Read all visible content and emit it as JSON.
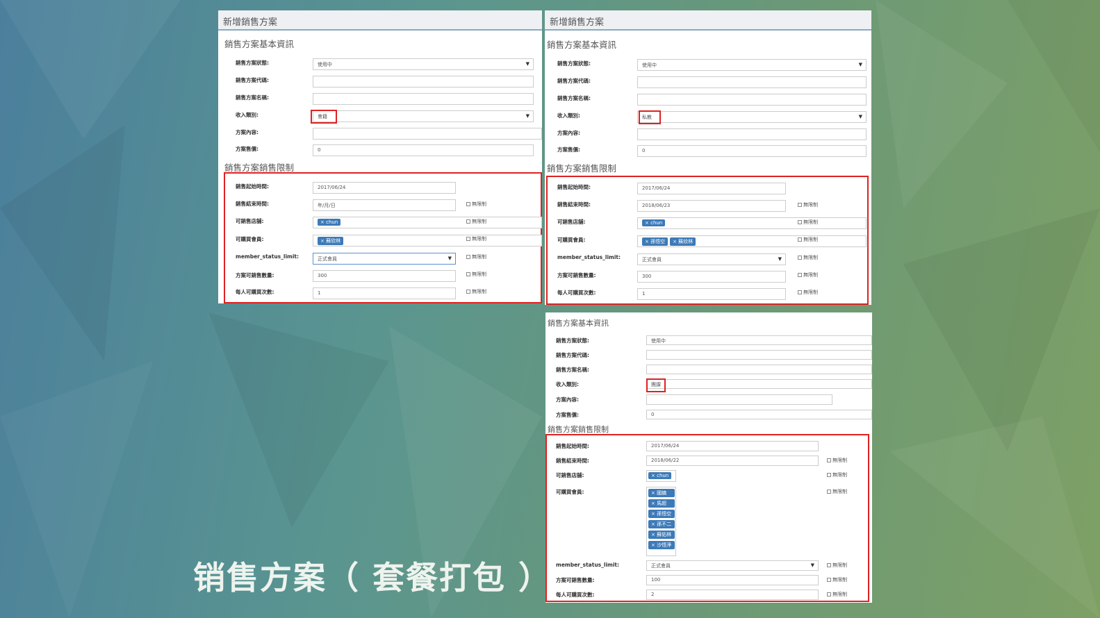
{
  "caption": "销售方案（ 套餐打包 ）",
  "panelA": {
    "title": "新增銷售方案",
    "basic_title": "銷售方案基本資訊",
    "limit_title": "銷售方案銷售限制",
    "labels": {
      "status": "銷售方案狀態:",
      "code": "銷售方案代碼:",
      "name": "銷售方案名稱:",
      "income": "收入類別:",
      "content": "方案內容:",
      "price": "方案售價:",
      "start": "銷售起始時間:",
      "end": "銷售結束時間:",
      "store": "可銷售店舖:",
      "member": "可購買會員:",
      "msl": "member_status_limit:",
      "qty": "方案可銷售數量:",
      "per": "每人可購買次數:"
    },
    "values": {
      "status": "使用中",
      "income": "會籍",
      "price": "0",
      "start": "2017/06/24",
      "end": "年/月/日",
      "store_tag": "× chun",
      "member_tag": "× 蘇欣林",
      "msl": "正式會員",
      "qty": "300",
      "per": "1"
    },
    "unlimited": "無限制"
  },
  "panelB": {
    "title": "新增銷售方案",
    "basic_title": "銷售方案基本資訊",
    "limit_title": "銷售方案銷售限制",
    "labels": {
      "status": "銷售方案狀態:",
      "code": "銷售方案代碼:",
      "name": "銷售方案名稱:",
      "income": "收入類別:",
      "content": "方案內容:",
      "price": "方案售價:",
      "start": "銷售起始時間:",
      "end": "銷售結束時間:",
      "store": "可銷售店舖:",
      "member": "可購買會員:",
      "msl": "member_status_limit:",
      "qty": "方案可銷售數量:",
      "per": "每人可購買次數:"
    },
    "values": {
      "status": "使用中",
      "income": "私教",
      "price": "0",
      "start": "2017/06/24",
      "end": "2018/06/23",
      "store_tag": "× chun",
      "member_tag1": "× 孫悟空",
      "member_tag2": "× 蘇欣林",
      "msl": "正式會員",
      "qty": "300",
      "per": "1"
    },
    "unlimited": "無限制"
  },
  "panelC": {
    "basic_title": "銷售方案基本資訊",
    "limit_title": "銷售方案銷售限制",
    "labels": {
      "status": "銷售方案狀態:",
      "code": "銷售方案代碼:",
      "name": "銷售方案名稱:",
      "income": "收入類別:",
      "content": "方案內容:",
      "price": "方案售價:",
      "start": "銷售起始時間:",
      "end": "銷售結束時間:",
      "store": "可銷售店舖:",
      "member": "可購買會員:",
      "msl": "member_status_limit:",
      "qty": "方案可銷售數量:",
      "per": "每人可購買次數:"
    },
    "values": {
      "status": "使用中",
      "income": "團課",
      "price": "0",
      "start": "2017/06/24",
      "end": "2018/06/22",
      "store_tag": "× chun",
      "members": [
        "× 國鎮",
        "× 馬超",
        "× 孫悟空",
        "× 孫不二",
        "× 蘇佑林",
        "× 沙悟淨"
      ],
      "msl": "正式會員",
      "qty": "100",
      "per": "2"
    },
    "unlimited": "無限制"
  }
}
